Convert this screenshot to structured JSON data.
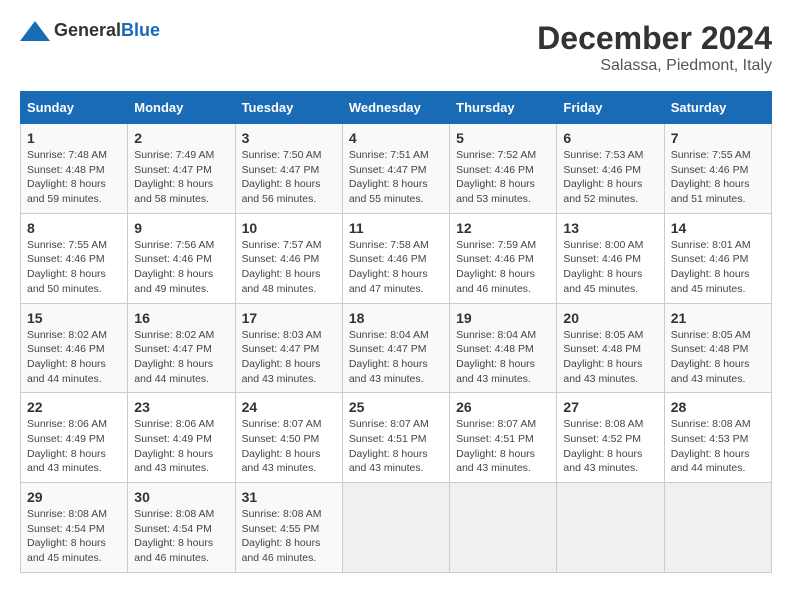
{
  "header": {
    "logo": {
      "text1": "General",
      "text2": "Blue"
    },
    "title": "December 2024",
    "subtitle": "Salassa, Piedmont, Italy"
  },
  "weekdays": [
    "Sunday",
    "Monday",
    "Tuesday",
    "Wednesday",
    "Thursday",
    "Friday",
    "Saturday"
  ],
  "weeks": [
    [
      {
        "day": "1",
        "sunrise": "7:48 AM",
        "sunset": "4:48 PM",
        "daylight": "8 hours and 59 minutes."
      },
      {
        "day": "2",
        "sunrise": "7:49 AM",
        "sunset": "4:47 PM",
        "daylight": "8 hours and 58 minutes."
      },
      {
        "day": "3",
        "sunrise": "7:50 AM",
        "sunset": "4:47 PM",
        "daylight": "8 hours and 56 minutes."
      },
      {
        "day": "4",
        "sunrise": "7:51 AM",
        "sunset": "4:47 PM",
        "daylight": "8 hours and 55 minutes."
      },
      {
        "day": "5",
        "sunrise": "7:52 AM",
        "sunset": "4:46 PM",
        "daylight": "8 hours and 53 minutes."
      },
      {
        "day": "6",
        "sunrise": "7:53 AM",
        "sunset": "4:46 PM",
        "daylight": "8 hours and 52 minutes."
      },
      {
        "day": "7",
        "sunrise": "7:55 AM",
        "sunset": "4:46 PM",
        "daylight": "8 hours and 51 minutes."
      }
    ],
    [
      {
        "day": "8",
        "sunrise": "7:55 AM",
        "sunset": "4:46 PM",
        "daylight": "8 hours and 50 minutes."
      },
      {
        "day": "9",
        "sunrise": "7:56 AM",
        "sunset": "4:46 PM",
        "daylight": "8 hours and 49 minutes."
      },
      {
        "day": "10",
        "sunrise": "7:57 AM",
        "sunset": "4:46 PM",
        "daylight": "8 hours and 48 minutes."
      },
      {
        "day": "11",
        "sunrise": "7:58 AM",
        "sunset": "4:46 PM",
        "daylight": "8 hours and 47 minutes."
      },
      {
        "day": "12",
        "sunrise": "7:59 AM",
        "sunset": "4:46 PM",
        "daylight": "8 hours and 46 minutes."
      },
      {
        "day": "13",
        "sunrise": "8:00 AM",
        "sunset": "4:46 PM",
        "daylight": "8 hours and 45 minutes."
      },
      {
        "day": "14",
        "sunrise": "8:01 AM",
        "sunset": "4:46 PM",
        "daylight": "8 hours and 45 minutes."
      }
    ],
    [
      {
        "day": "15",
        "sunrise": "8:02 AM",
        "sunset": "4:46 PM",
        "daylight": "8 hours and 44 minutes."
      },
      {
        "day": "16",
        "sunrise": "8:02 AM",
        "sunset": "4:47 PM",
        "daylight": "8 hours and 44 minutes."
      },
      {
        "day": "17",
        "sunrise": "8:03 AM",
        "sunset": "4:47 PM",
        "daylight": "8 hours and 43 minutes."
      },
      {
        "day": "18",
        "sunrise": "8:04 AM",
        "sunset": "4:47 PM",
        "daylight": "8 hours and 43 minutes."
      },
      {
        "day": "19",
        "sunrise": "8:04 AM",
        "sunset": "4:48 PM",
        "daylight": "8 hours and 43 minutes."
      },
      {
        "day": "20",
        "sunrise": "8:05 AM",
        "sunset": "4:48 PM",
        "daylight": "8 hours and 43 minutes."
      },
      {
        "day": "21",
        "sunrise": "8:05 AM",
        "sunset": "4:48 PM",
        "daylight": "8 hours and 43 minutes."
      }
    ],
    [
      {
        "day": "22",
        "sunrise": "8:06 AM",
        "sunset": "4:49 PM",
        "daylight": "8 hours and 43 minutes."
      },
      {
        "day": "23",
        "sunrise": "8:06 AM",
        "sunset": "4:49 PM",
        "daylight": "8 hours and 43 minutes."
      },
      {
        "day": "24",
        "sunrise": "8:07 AM",
        "sunset": "4:50 PM",
        "daylight": "8 hours and 43 minutes."
      },
      {
        "day": "25",
        "sunrise": "8:07 AM",
        "sunset": "4:51 PM",
        "daylight": "8 hours and 43 minutes."
      },
      {
        "day": "26",
        "sunrise": "8:07 AM",
        "sunset": "4:51 PM",
        "daylight": "8 hours and 43 minutes."
      },
      {
        "day": "27",
        "sunrise": "8:08 AM",
        "sunset": "4:52 PM",
        "daylight": "8 hours and 43 minutes."
      },
      {
        "day": "28",
        "sunrise": "8:08 AM",
        "sunset": "4:53 PM",
        "daylight": "8 hours and 44 minutes."
      }
    ],
    [
      {
        "day": "29",
        "sunrise": "8:08 AM",
        "sunset": "4:54 PM",
        "daylight": "8 hours and 45 minutes."
      },
      {
        "day": "30",
        "sunrise": "8:08 AM",
        "sunset": "4:54 PM",
        "daylight": "8 hours and 46 minutes."
      },
      {
        "day": "31",
        "sunrise": "8:08 AM",
        "sunset": "4:55 PM",
        "daylight": "8 hours and 46 minutes."
      },
      null,
      null,
      null,
      null
    ]
  ],
  "labels": {
    "sunrise": "Sunrise:",
    "sunset": "Sunset:",
    "daylight": "Daylight:"
  }
}
